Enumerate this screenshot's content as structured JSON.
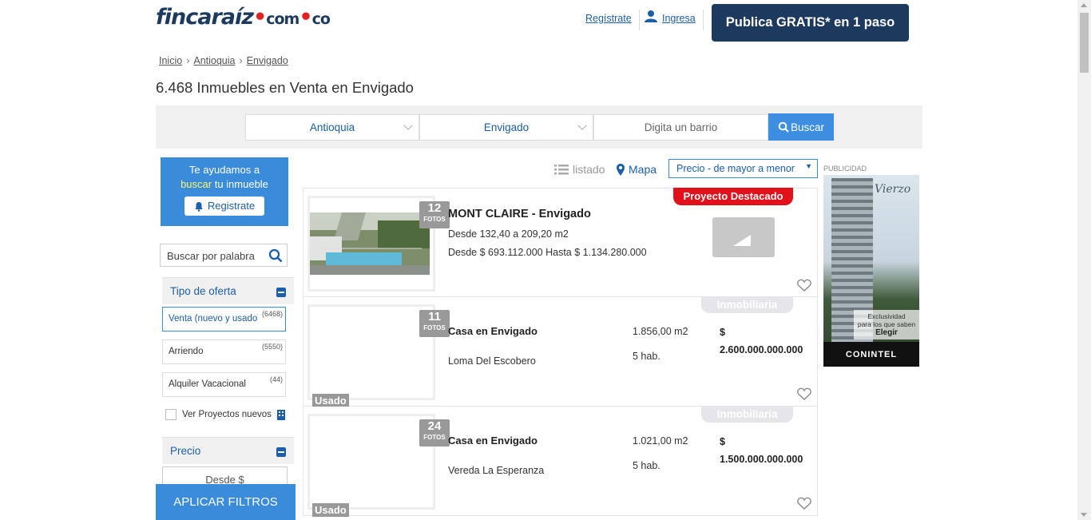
{
  "header": {
    "logo_main": "fincaraíz",
    "logo_com": "com",
    "logo_co": "co",
    "register_label": "Regístrate",
    "login_label": "Ingresa",
    "publish_label": "Publica GRATIS* en 1 paso"
  },
  "breadcrumb": [
    "Inicio",
    "Antioquia",
    "Envigado"
  ],
  "page_title": "6.468 Inmuebles en Venta en Envigado",
  "search": {
    "department": "Antioquia",
    "city": "Envigado",
    "neighborhood_placeholder": "Digita un barrio",
    "button_label": "Buscar"
  },
  "sidebar": {
    "help_line1": "Te ayudamos a",
    "help_highlight": "buscar",
    "help_line2": " tu inmueble",
    "help_button": "Registrate",
    "keyword_placeholder": "Buscar por palabra",
    "offer_title": "Tipo de oferta",
    "offers": [
      {
        "label": "Venta (nuevo y usado)",
        "count": "(6468)"
      },
      {
        "label": "Arriendo",
        "count": "(5550)"
      },
      {
        "label": "Alquiler Vacacional",
        "count": "(44)"
      }
    ],
    "projects_label": "Ver Proyectos nuevos",
    "price_title": "Precio",
    "price_from": "Desde $",
    "apply_label": "APLICAR FILTROS"
  },
  "view": {
    "list_label": "listado",
    "map_label": "Mapa",
    "sort_label": "Precio - de mayor a menor"
  },
  "listings": [
    {
      "photos": "12",
      "photos_label": "FOTOS",
      "badge": "Proyecto Destacado",
      "title": "MONT CLAIRE - Envigado",
      "line1": "Desde 132,40 a 209,20 m2",
      "line2": "Desde $ 693.112.000 Hasta $ 1.134.280.000"
    },
    {
      "photos": "11",
      "photos_label": "FOTOS",
      "badge": "Inmobiliaria",
      "condition": "Usado",
      "title": "Casa en Envigado",
      "location": "Loma Del Escobero",
      "area": "1.856,00 m2",
      "rooms": "5 hab.",
      "price_symbol": "$",
      "price": "2.600.000.000.000"
    },
    {
      "photos": "24",
      "photos_label": "FOTOS",
      "badge": "Inmobiliaria",
      "condition": "Usado",
      "title": "Casa en Envigado",
      "location": "Vereda La Esperanza",
      "area": "1.021,00 m2",
      "rooms": "5 hab.",
      "price_symbol": "$",
      "price": "1.500.000.000.000"
    }
  ],
  "ad": {
    "label": "PUBLICIDAD",
    "brand": "Vierzo",
    "tag1": "Exclusividad",
    "tag2": "para los que saben",
    "tag3": "Elegir",
    "footer": "CONINTEL"
  },
  "colors": {
    "brand_dark": "#1c3a5e",
    "accent_blue": "#3a8bd9",
    "badge_red": "#e2101a"
  }
}
